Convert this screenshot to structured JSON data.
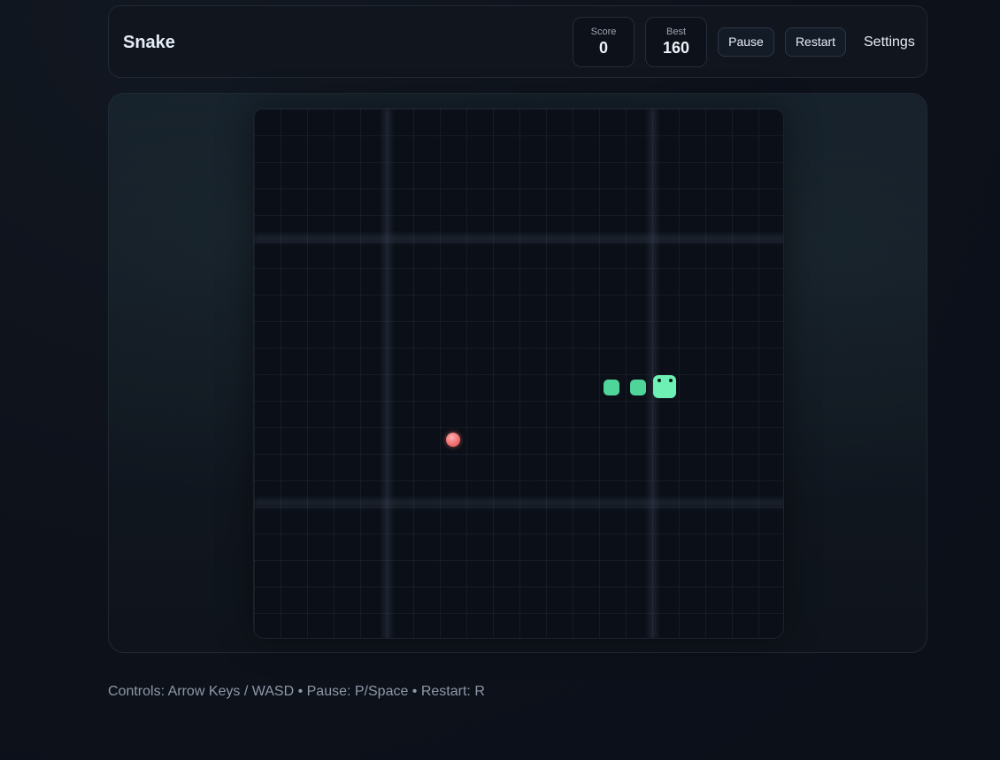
{
  "header": {
    "title": "Snake",
    "score_label": "Score",
    "score_value": "0",
    "best_label": "Best",
    "best_value": "160",
    "pause_label": "Pause",
    "restart_label": "Restart",
    "settings_label": "Settings"
  },
  "game": {
    "grid_cells": 20,
    "snake_head_color": "#6ef0b4",
    "snake_body_color": "#4fd49a",
    "food_color": "#f07070",
    "board_color": "#0b0f17"
  },
  "footer": {
    "controls_text": "Controls: Arrow Keys / WASD • Pause: P/Space • Restart: R"
  }
}
